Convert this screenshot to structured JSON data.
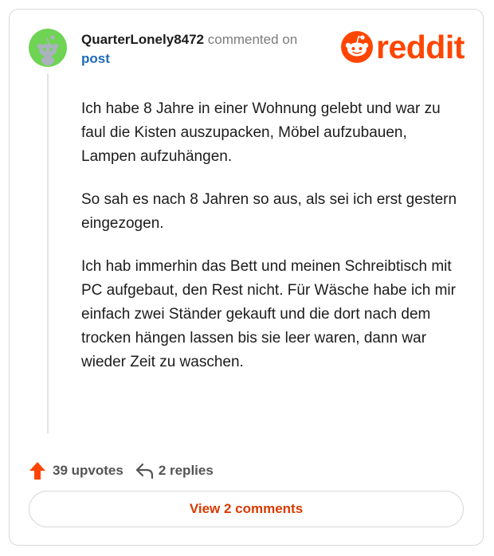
{
  "comment": {
    "username": "QuarterLonely8472",
    "action": "commented on",
    "post_link": "post",
    "paragraphs": [
      "Ich habe 8 Jahre in einer Wohnung gelebt und war zu faul die Kisten auszupacken, Möbel aufzubauen, Lampen aufzuhängen.",
      "So sah es nach 8 Jahren so aus, als sei ich erst gestern eingezogen.",
      "Ich hab immerhin das Bett und meinen Schreibtisch mit PC aufgebaut, den Rest nicht. Für Wäsche habe ich mir einfach zwei Ständer gekauft und die dort nach dem trocken hängen lassen bis sie leer waren, dann war wieder Zeit zu waschen."
    ],
    "upvotes": "39 upvotes",
    "replies": "2 replies",
    "view_button": "View 2 comments"
  },
  "brand": {
    "logo_text": "reddit",
    "accent": "#ff4500",
    "avatar_color": "#6fd354"
  },
  "icons": {
    "avatar": "snoo-avatar-icon",
    "logo": "reddit-snoo-icon",
    "upvote": "upvote-arrow-icon",
    "reply": "reply-arrow-icon"
  }
}
